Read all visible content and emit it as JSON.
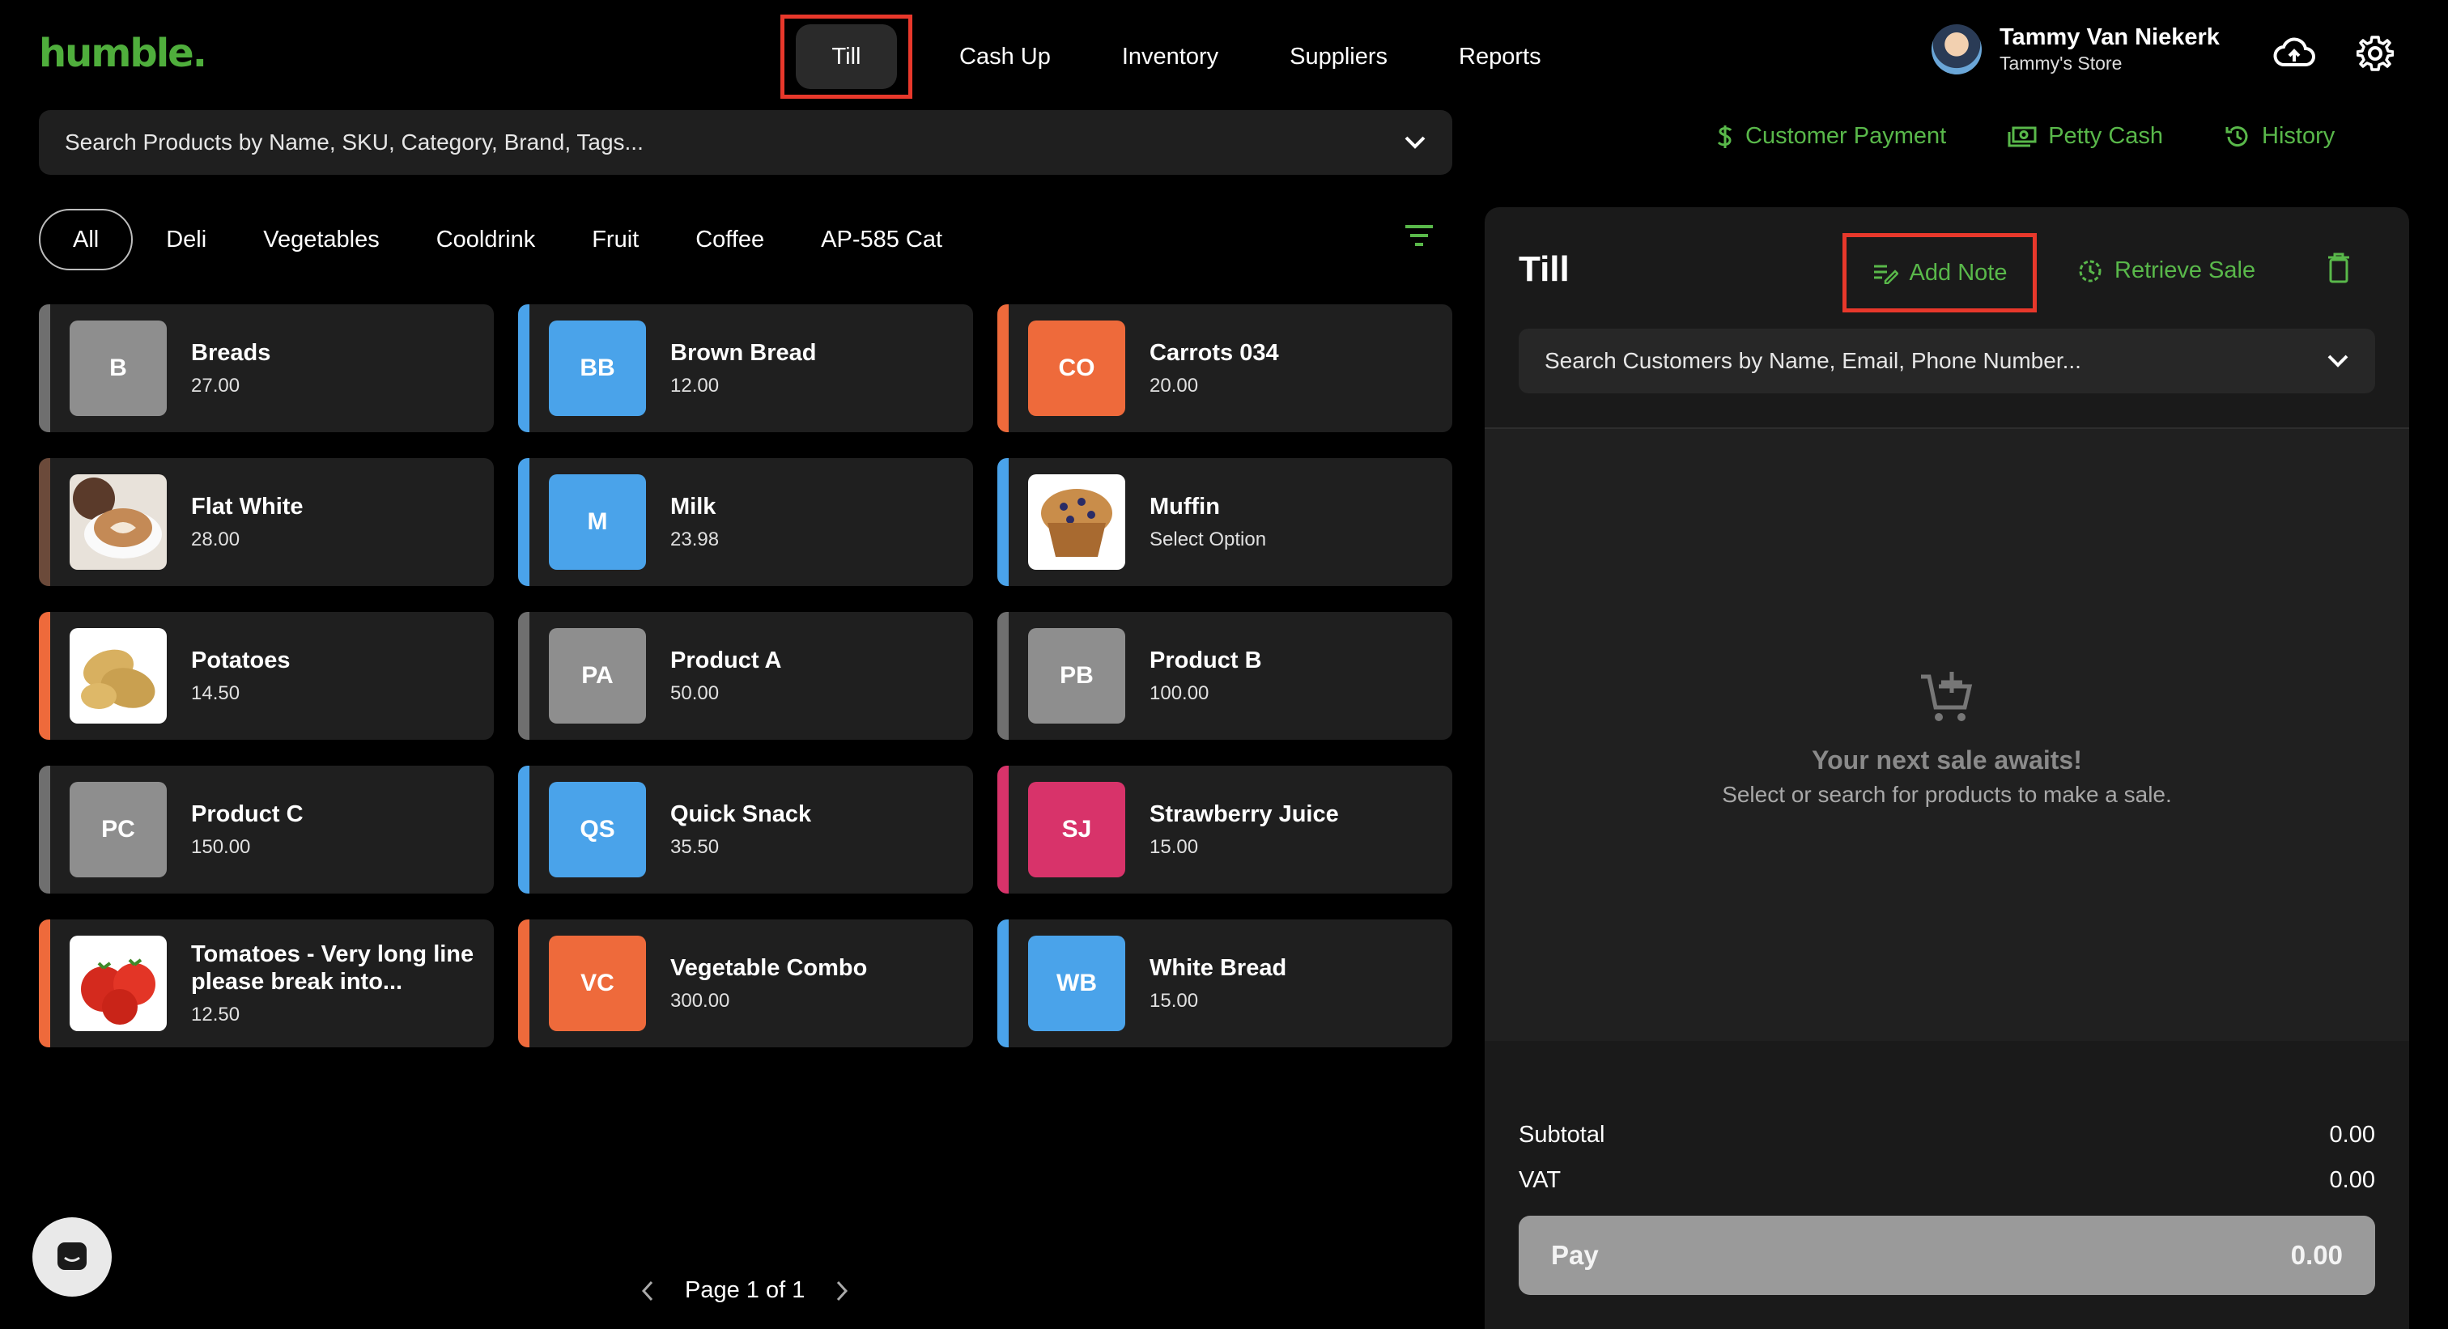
{
  "app": {
    "logo": "humble."
  },
  "nav": {
    "tabs": [
      {
        "label": "Till",
        "active": true
      },
      {
        "label": "Cash Up"
      },
      {
        "label": "Inventory"
      },
      {
        "label": "Suppliers"
      },
      {
        "label": "Reports"
      }
    ]
  },
  "user": {
    "name": "Tammy Van Niekerk",
    "store": "Tammy's Store"
  },
  "header_icons": [
    "cloud-upload-icon",
    "gear-icon"
  ],
  "product_search": {
    "placeholder": "Search Products by Name, SKU, Category, Brand, Tags..."
  },
  "quick_actions": {
    "customer_payment": "Customer Payment",
    "petty_cash": "Petty Cash",
    "history": "History"
  },
  "categories": [
    "All",
    "Deli",
    "Vegetables",
    "Cooldrink",
    "Fruit",
    "Coffee",
    "AP-585 Cat"
  ],
  "products": [
    {
      "name": "Breads",
      "price": "27.00",
      "initials": "B",
      "color": "#8e8e8e",
      "stripe": "#6f6f6f"
    },
    {
      "name": "Brown Bread",
      "price": "12.00",
      "initials": "BB",
      "color": "#4aa3ea",
      "stripe": "#4aa3ea"
    },
    {
      "name": "Carrots 034",
      "price": "20.00",
      "initials": "CO",
      "color": "#ee6a3b",
      "stripe": "#ee6a3b"
    },
    {
      "name": "Flat White",
      "price": "28.00",
      "image": "coffee",
      "stripe": "#6b4a3a"
    },
    {
      "name": "Milk",
      "price": "23.98",
      "initials": "M",
      "color": "#4aa3ea",
      "stripe": "#4aa3ea"
    },
    {
      "name": "Muffin",
      "price": "Select Option",
      "image": "muffin",
      "stripe": "#4aa3ea"
    },
    {
      "name": "Potatoes",
      "price": "14.50",
      "image": "potato",
      "stripe": "#ee6a3b"
    },
    {
      "name": "Product A",
      "price": "50.00",
      "initials": "PA",
      "color": "#8e8e8e",
      "stripe": "#6f6f6f"
    },
    {
      "name": "Product B",
      "price": "100.00",
      "initials": "PB",
      "color": "#8e8e8e",
      "stripe": "#6f6f6f"
    },
    {
      "name": "Product C",
      "price": "150.00",
      "initials": "PC",
      "color": "#8e8e8e",
      "stripe": "#6f6f6f"
    },
    {
      "name": "Quick Snack",
      "price": "35.50",
      "initials": "QS",
      "color": "#4aa3ea",
      "stripe": "#4aa3ea"
    },
    {
      "name": "Strawberry Juice",
      "price": "15.00",
      "initials": "SJ",
      "color": "#d8336a",
      "stripe": "#d8336a"
    },
    {
      "name": "Tomatoes - Very long line please break into...",
      "price": "12.50",
      "image": "tomato",
      "stripe": "#ee6a3b"
    },
    {
      "name": "Vegetable Combo",
      "price": "300.00",
      "initials": "VC",
      "color": "#ee6a3b",
      "stripe": "#ee6a3b"
    },
    {
      "name": "White Bread",
      "price": "15.00",
      "initials": "WB",
      "color": "#4aa3ea",
      "stripe": "#4aa3ea"
    }
  ],
  "pagination": {
    "label": "Page 1 of 1"
  },
  "till": {
    "title": "Till",
    "add_note": "Add Note",
    "retrieve_sale": "Retrieve Sale",
    "customer_search": {
      "placeholder": "Search Customers by Name, Email, Phone Number..."
    },
    "empty_title": "Your next sale awaits!",
    "empty_sub": "Select or search for products to make a sale.",
    "subtotal_label": "Subtotal",
    "subtotal": "0.00",
    "vat_label": "VAT",
    "vat": "0.00",
    "pay_label": "Pay",
    "pay_amount": "0.00"
  },
  "colors": {
    "accent": "#59b84a",
    "highlight": "#e8382b"
  }
}
